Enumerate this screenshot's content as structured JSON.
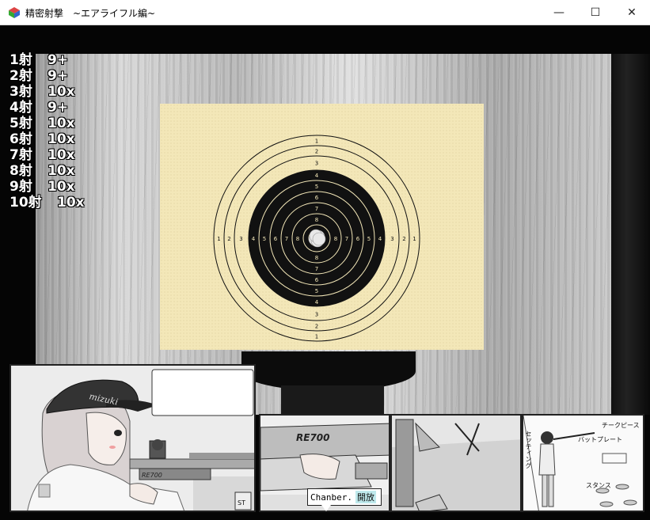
{
  "window": {
    "title": "精密射撃　~エアライフル編~",
    "minimize_label": "—",
    "maximize_label": "☐",
    "close_label": "✕"
  },
  "scores": [
    {
      "shot": "1射",
      "score": "9+"
    },
    {
      "shot": "2射",
      "score": "9+"
    },
    {
      "shot": "3射",
      "score": "10x"
    },
    {
      "shot": "4射",
      "score": "9+"
    },
    {
      "shot": "5射",
      "score": "10x"
    },
    {
      "shot": "6射",
      "score": "10x"
    },
    {
      "shot": "7射",
      "score": "10x"
    },
    {
      "shot": "8射",
      "score": "10x"
    },
    {
      "shot": "9射",
      "score": "10x"
    },
    {
      "shot": "10射",
      "score": "10x"
    }
  ],
  "target": {
    "ring_numbers": [
      "1",
      "2",
      "3",
      "4",
      "5",
      "6",
      "7",
      "8"
    ]
  },
  "panels": {
    "cap_text": "mizuki",
    "rifle_text": "RE700",
    "chamber_label": "Chanber.",
    "chamber_state": "開放",
    "diagram_labels": [
      "チークピース",
      "バットプレート",
      "セッティング",
      "スタンス"
    ],
    "corner_mark": "ST"
  }
}
